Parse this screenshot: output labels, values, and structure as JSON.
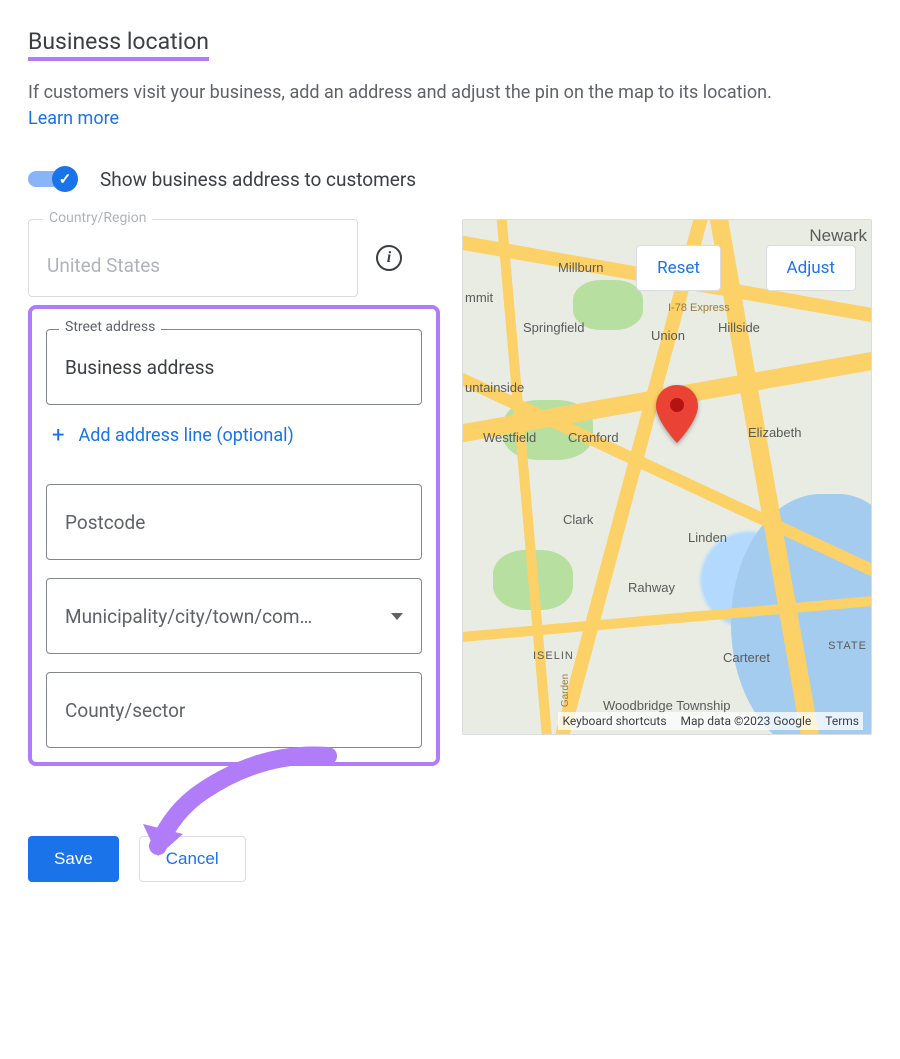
{
  "header": {
    "title": "Business location",
    "description": "If customers visit your business, add an address and adjust the pin on the map to its location.",
    "learn_more": "Learn more"
  },
  "toggle": {
    "label": "Show business address to customers",
    "on": true
  },
  "fields": {
    "country_label": "Country/Region",
    "country_value": "United States",
    "street_label": "Street address",
    "street_value": "Business address",
    "add_line": "Add address line (optional)",
    "postcode_placeholder": "Postcode",
    "municipality_placeholder": "Municipality/city/town/com…",
    "county_placeholder": "County/sector"
  },
  "map": {
    "reset": "Reset",
    "adjust": "Adjust",
    "cities": {
      "newark": "Newark",
      "millburn": "Millburn",
      "summit": "mmit",
      "springfield": "Springfield",
      "union": "Union",
      "hillside": "Hillside",
      "mountainside": "untainside",
      "westfield": "Westfield",
      "cranford": "Cranford",
      "elizabeth": "Elizabeth",
      "clark": "Clark",
      "linden": "Linden",
      "rahway": "Rahway",
      "iselin": "ISELIN",
      "carteret": "Carteret",
      "woodbridge": "Woodbridge Township",
      "garden": "Garden",
      "state": "STATE",
      "i78express": "I-78 Express"
    },
    "attrib": {
      "shortcuts": "Keyboard shortcuts",
      "data": "Map data ©2023 Google",
      "terms": "Terms"
    }
  },
  "actions": {
    "save": "Save",
    "cancel": "Cancel"
  }
}
